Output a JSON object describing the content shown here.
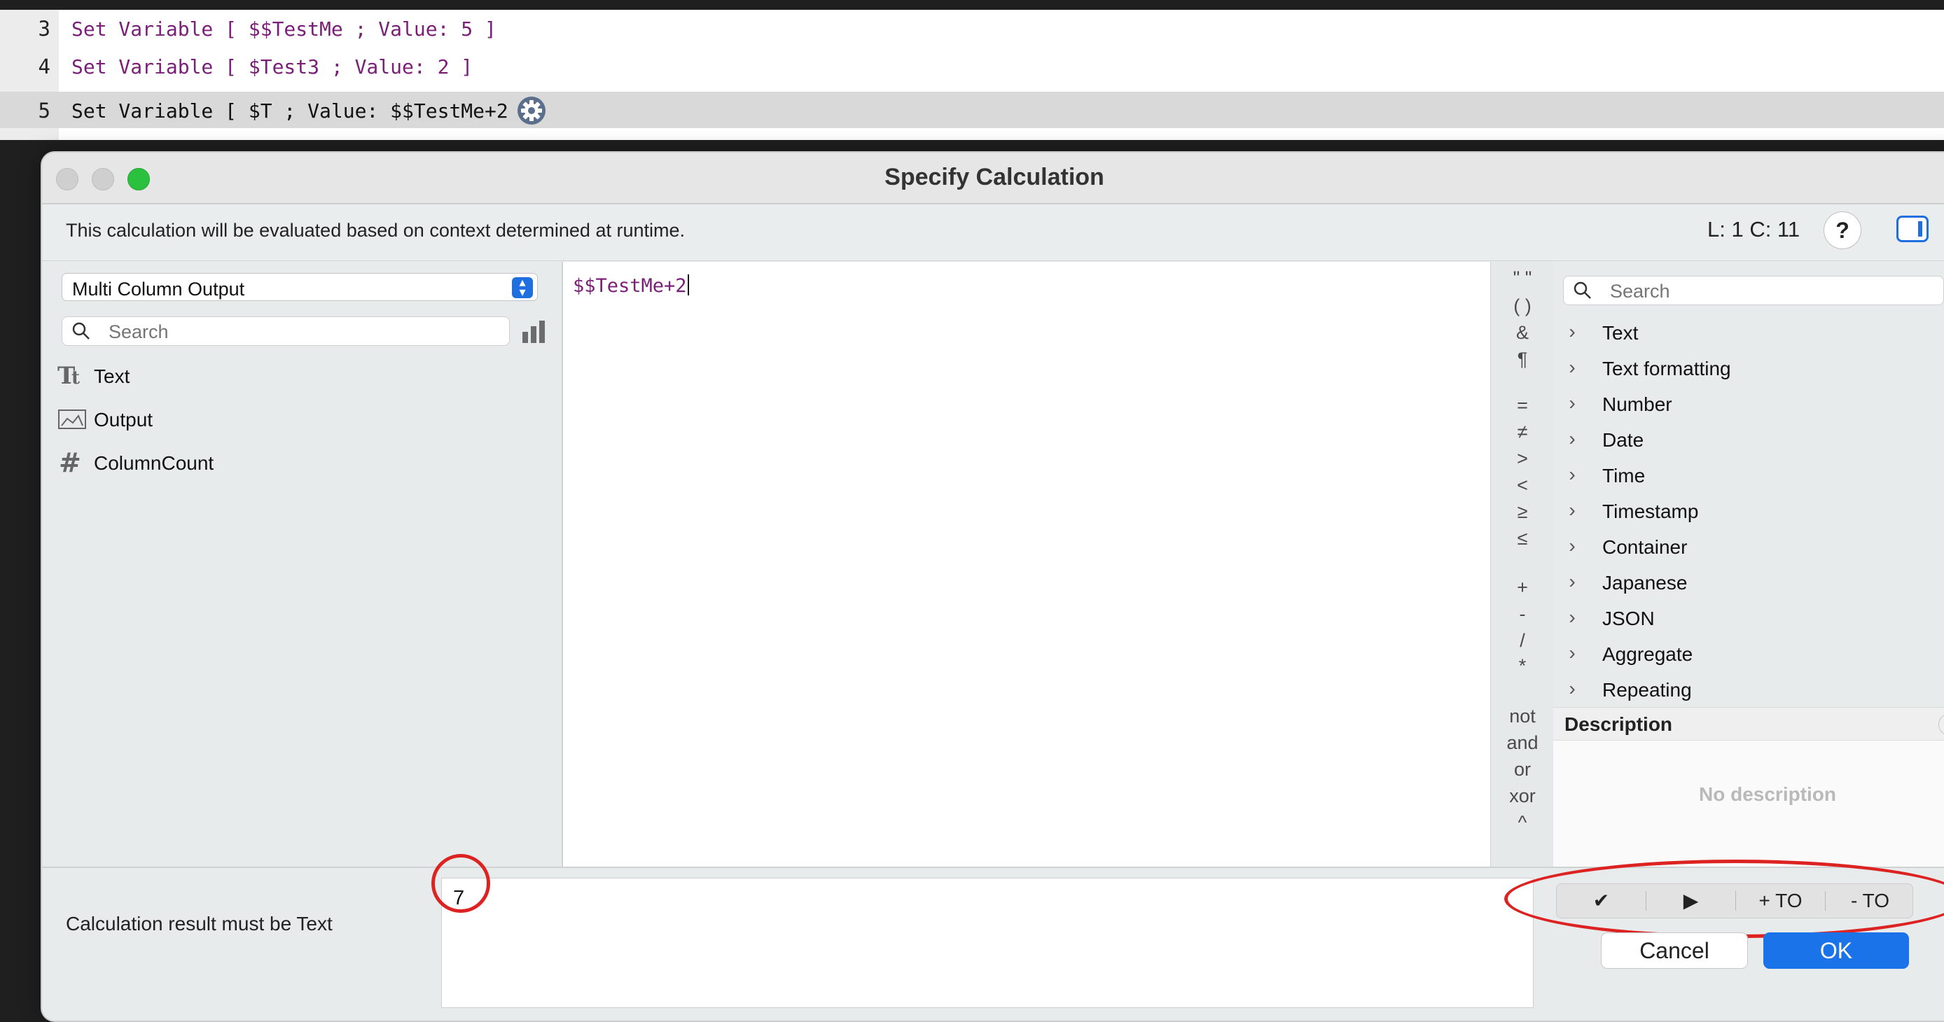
{
  "script": {
    "lines": [
      {
        "number": "3",
        "text": "Set Variable [ $$TestMe ; Value: 5 ]"
      },
      {
        "number": "4",
        "text": "Set Variable [ $Test3 ; Value: 2 ]"
      },
      {
        "number": "5",
        "text": "Set Variable [ $T ; Value: $$TestMe+2 ]"
      }
    ],
    "gear_icon": "gear-icon"
  },
  "dialog": {
    "title": "Specify Calculation",
    "context_note": "This calculation will be evaluated based on context determined at runtime.",
    "line_col": "L: 1 C: 11",
    "help_label": "?"
  },
  "fields_panel": {
    "table_select": "Multi Column Output",
    "search_placeholder": "Search",
    "fields": [
      {
        "label": "Text",
        "icon": "text-field-icon"
      },
      {
        "label": "Output",
        "icon": "container-field-icon"
      },
      {
        "label": "ColumnCount",
        "icon": "number-field-icon"
      }
    ]
  },
  "editor": {
    "formula": "$$TestMe+2"
  },
  "operators": [
    "\" \"",
    "( )",
    "&",
    "¶",
    "=",
    "≠",
    ">",
    "<",
    "≥",
    "≤",
    "+",
    "-",
    "/",
    "*",
    "not",
    "and",
    "or",
    "xor",
    "^"
  ],
  "functions_panel": {
    "search_placeholder": "Search",
    "categories": [
      "Text",
      "Text formatting",
      "Number",
      "Date",
      "Time",
      "Timestamp",
      "Container",
      "Japanese",
      "JSON",
      "Aggregate",
      "Repeating"
    ]
  },
  "description": {
    "title": "Description",
    "help_label": "?",
    "empty_text": "No description"
  },
  "bottom": {
    "result_type_label": "Calculation result must be  Text",
    "result_value": "7",
    "debug_buttons": [
      "✔",
      "▶",
      "+ TO",
      "- TO"
    ],
    "cancel_label": "Cancel",
    "ok_label": "OK"
  },
  "colors": {
    "accent": "#1a73e8",
    "variable_purple": "#7a1f78",
    "annotation_red": "#dd2222",
    "zoom_green": "#2bc13f"
  }
}
